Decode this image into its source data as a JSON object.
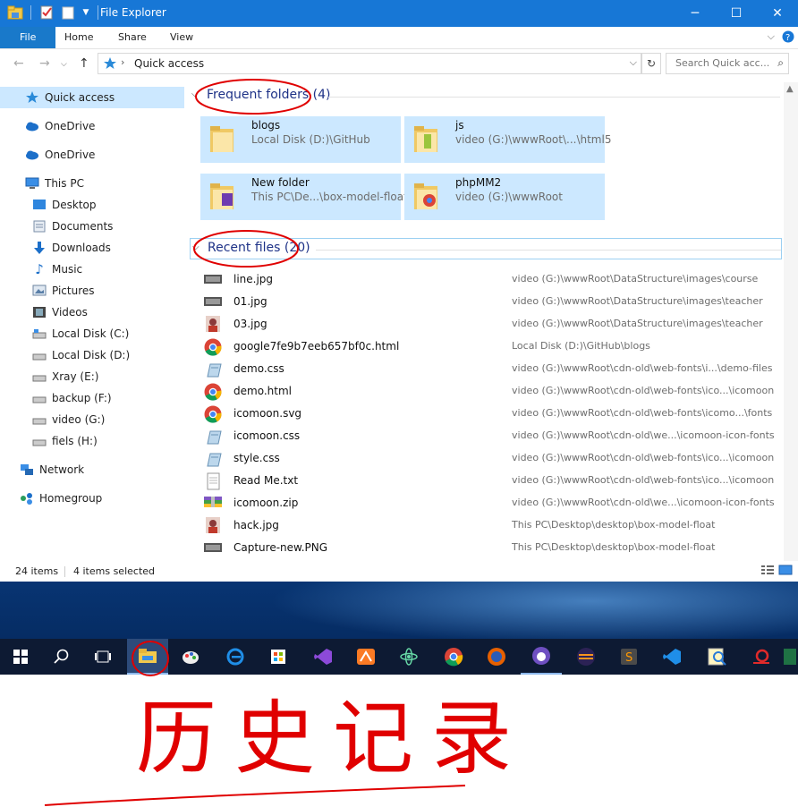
{
  "window": {
    "title": "File Explorer",
    "controls": [
      "minimize",
      "maximize",
      "close"
    ]
  },
  "ribbon": {
    "tabs": [
      "File",
      "Home",
      "Share",
      "View"
    ]
  },
  "address": {
    "path": "Quick access",
    "search_placeholder": "Search Quick acc..."
  },
  "nav": {
    "items": [
      {
        "label": "Quick access",
        "icon": "star-icon"
      },
      {
        "label": "OneDrive",
        "icon": "cloud-icon"
      },
      {
        "label": "OneDrive",
        "icon": "cloud-icon"
      },
      {
        "label": "This PC",
        "icon": "computer-icon"
      },
      {
        "label": "Desktop",
        "icon": "desktop-icon"
      },
      {
        "label": "Documents",
        "icon": "documents-icon"
      },
      {
        "label": "Downloads",
        "icon": "download-arrow-icon"
      },
      {
        "label": "Music",
        "icon": "music-note-icon"
      },
      {
        "label": "Pictures",
        "icon": "pictures-icon"
      },
      {
        "label": "Videos",
        "icon": "film-icon"
      },
      {
        "label": "Local Disk (C:)",
        "icon": "drive-icon"
      },
      {
        "label": "Local Disk (D:)",
        "icon": "drive-icon"
      },
      {
        "label": "Xray (E:)",
        "icon": "drive-icon"
      },
      {
        "label": "backup (F:)",
        "icon": "drive-icon"
      },
      {
        "label": "video (G:)",
        "icon": "drive-icon"
      },
      {
        "label": "fiels (H:)",
        "icon": "drive-icon"
      },
      {
        "label": "Network",
        "icon": "network-icon"
      },
      {
        "label": "Homegroup",
        "icon": "homegroup-icon"
      }
    ]
  },
  "frequent": {
    "header": "Frequent folders (4)",
    "folders": [
      {
        "name": "blogs",
        "location": "Local Disk (D:)\\GitHub"
      },
      {
        "name": "js",
        "location": "video (G:)\\wwwRoot\\...\\html5"
      },
      {
        "name": "New folder",
        "location": "This PC\\De...\\box-model-float"
      },
      {
        "name": "phpMM2",
        "location": "video (G:)\\wwwRoot"
      }
    ]
  },
  "recent": {
    "header": "Recent files (20)",
    "files": [
      {
        "name": "line.jpg",
        "location": "video (G:)\\wwwRoot\\DataStructure\\images\\course",
        "icon": "image-thumb-icon"
      },
      {
        "name": "01.jpg",
        "location": "video (G:)\\wwwRoot\\DataStructure\\images\\teacher",
        "icon": "image-thumb-icon"
      },
      {
        "name": "03.jpg",
        "location": "video (G:)\\wwwRoot\\DataStructure\\images\\teacher",
        "icon": "portrait-thumb-icon"
      },
      {
        "name": "google7fe9b7eeb657bf0c.html",
        "location": "Local Disk (D:)\\GitHub\\blogs",
        "icon": "chrome-icon"
      },
      {
        "name": "demo.css",
        "location": "video (G:)\\wwwRoot\\cdn-old\\web-fonts\\i...\\demo-files",
        "icon": "css-file-icon"
      },
      {
        "name": "demo.html",
        "location": "video (G:)\\wwwRoot\\cdn-old\\web-fonts\\ico...\\icomoon",
        "icon": "chrome-icon"
      },
      {
        "name": "icomoon.svg",
        "location": "video (G:)\\wwwRoot\\cdn-old\\web-fonts\\icomo...\\fonts",
        "icon": "chrome-icon"
      },
      {
        "name": "icomoon.css",
        "location": "video (G:)\\wwwRoot\\cdn-old\\we...\\icomoon-icon-fonts",
        "icon": "css-file-icon"
      },
      {
        "name": "style.css",
        "location": "video (G:)\\wwwRoot\\cdn-old\\web-fonts\\ico...\\icomoon",
        "icon": "css-file-icon"
      },
      {
        "name": "Read Me.txt",
        "location": "video (G:)\\wwwRoot\\cdn-old\\web-fonts\\ico...\\icomoon",
        "icon": "text-file-icon"
      },
      {
        "name": "icomoon.zip",
        "location": "video (G:)\\wwwRoot\\cdn-old\\we...\\icomoon-icon-fonts",
        "icon": "zip-archive-icon"
      },
      {
        "name": "hack.jpg",
        "location": "This PC\\Desktop\\desktop\\box-model-float",
        "icon": "portrait-thumb-icon"
      },
      {
        "name": "Capture-new.PNG",
        "location": "This PC\\Desktop\\desktop\\box-model-float",
        "icon": "image-thumb-icon"
      }
    ]
  },
  "status": {
    "count": "24 items",
    "selected": "4 items selected"
  },
  "taskbar": {
    "apps": [
      "start-icon",
      "search-icon",
      "task-view-icon",
      "file-explorer-icon",
      "paint-icon",
      "edge-icon",
      "store-icon",
      "visual-studio-icon",
      "xampp-icon",
      "atom-icon",
      "chrome-icon",
      "firefox-icon",
      "github-desktop-icon",
      "eclipse-icon",
      "sublime-text-icon",
      "vscode-icon",
      "search-tool-icon",
      "snail-icon",
      "excel-icon"
    ]
  },
  "annotation": {
    "handwritten_text": "历史记录",
    "ink_color": "#e00000"
  }
}
